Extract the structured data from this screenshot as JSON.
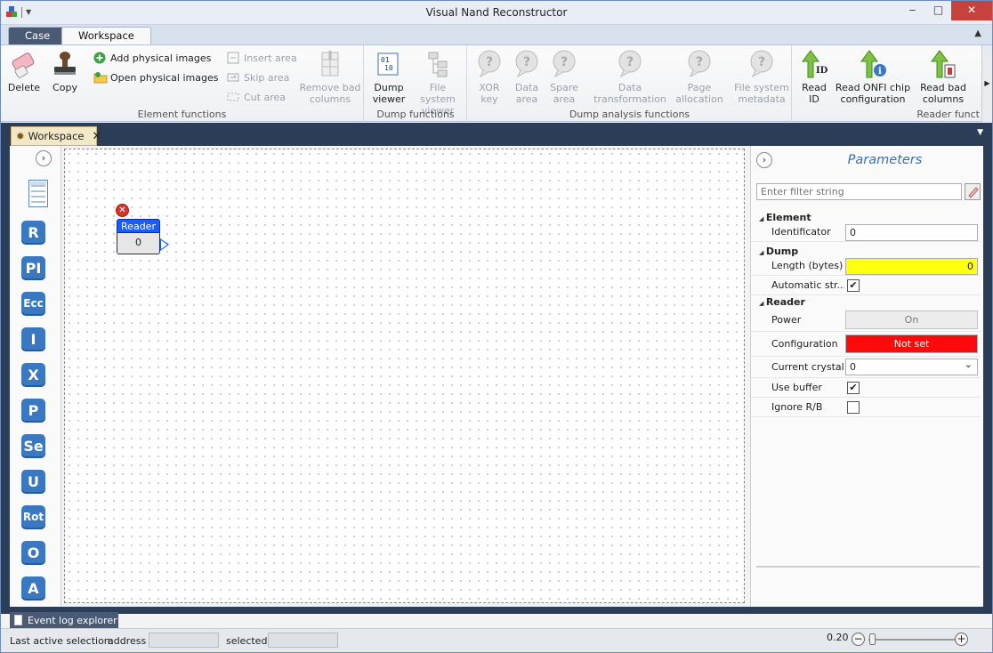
{
  "window": {
    "title": "Visual Nand Reconstructor",
    "min": "‒",
    "max": "□",
    "close": "✕"
  },
  "ribbon_tabs": [
    "Case",
    "Workspace"
  ],
  "ribbon": {
    "element_functions": {
      "label": "Element functions",
      "delete": "Delete",
      "copy": "Copy",
      "add_images": "Add physical images",
      "open_images": "Open physical images",
      "insert_area": "Insert area",
      "skip_area": "Skip area",
      "cut_area": "Cut area",
      "remove_bad_1": "Remove bad",
      "remove_bad_2": "columns"
    },
    "dump_functions": {
      "label": "Dump functions",
      "dump_viewer_1": "Dump",
      "dump_viewer_2": "viewer",
      "fs_viewer_1": "File system",
      "fs_viewer_2": "viewer"
    },
    "dump_analysis": {
      "label": "Dump analysis functions",
      "xor_1": "XOR",
      "xor_2": "key",
      "data_area_1": "Data",
      "data_area_2": "area",
      "spare_1": "Spare",
      "spare_2": "area",
      "transform_1": "Data",
      "transform_2": "transformation",
      "page_alloc_1": "Page",
      "page_alloc_2": "allocation",
      "fs_meta_1": "File system",
      "fs_meta_2": "metadata"
    },
    "reader_functions": {
      "label": "Reader funct",
      "read_id_1": "Read",
      "read_id_2": "ID",
      "read_id_badge": "ID",
      "read_onfi_1": "Read ONFI chip",
      "read_onfi_2": "configuration",
      "read_bad_1": "Read bad",
      "read_bad_2": "columns"
    }
  },
  "doc_tab": {
    "label": "Workspace",
    "close": "✕"
  },
  "toolbox": [
    "R",
    "PI",
    "Ecc",
    "I",
    "X",
    "P",
    "Se",
    "U",
    "Rot",
    "O",
    "A"
  ],
  "node": {
    "title": "Reader",
    "value": "0"
  },
  "params": {
    "title": "Parameters",
    "filter_placeholder": "Enter filter string",
    "sections": {
      "element": "Element",
      "dump": "Dump",
      "reader": "Reader"
    },
    "identificator_label": "Identificator",
    "identificator_value": "0",
    "length_label": "Length (bytes)",
    "length_value": "0",
    "auto_label": "Automatic str...",
    "auto_checked": "✔",
    "power_label": "Power",
    "power_value": "On",
    "config_label": "Configuration",
    "config_value": "Not set",
    "crystal_label": "Current crystal",
    "crystal_value": "0",
    "buffer_label": "Use buffer",
    "buffer_checked": "✔",
    "ignore_label": "Ignore R/B"
  },
  "event_tab": "Event log explorer",
  "status": {
    "last_active": "Last active selection:",
    "address": "address",
    "selected": "selected",
    "zoom": "0.20"
  }
}
